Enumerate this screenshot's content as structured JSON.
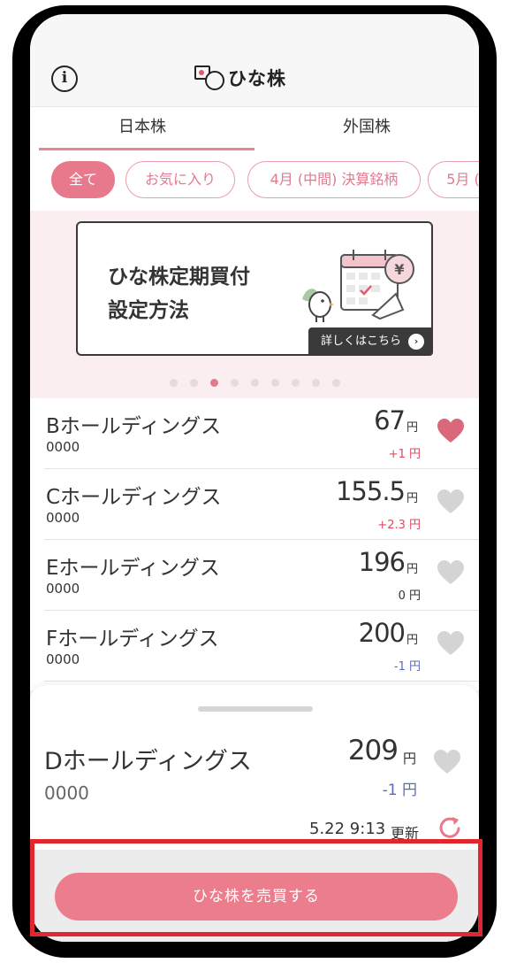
{
  "app": {
    "logo_text": "ひな株"
  },
  "header": {
    "info_icon": "i"
  },
  "tabs": [
    {
      "label": "日本株"
    },
    {
      "label": "外国株"
    }
  ],
  "filters": [
    {
      "label": "全て"
    },
    {
      "label": "お気に入り"
    },
    {
      "label": "4月 (中間) 決算銘柄"
    },
    {
      "label": "5月 ("
    }
  ],
  "banner": {
    "title_line1": "ひな株定期買付",
    "title_line2": "設定方法",
    "cta": "詳しくはこちら",
    "page_count": 9,
    "active_page": 3
  },
  "stocks": [
    {
      "name": "Bホールディングス",
      "code": "0000",
      "price": "67",
      "unit": "円",
      "change": "+1 円",
      "change_color": "#e0495e",
      "favorite": true
    },
    {
      "name": "Cホールディングス",
      "code": "0000",
      "price": "155.5",
      "unit": "円",
      "change": "+2.3 円",
      "change_color": "#e0495e",
      "favorite": false
    },
    {
      "name": "Eホールディングス",
      "code": "0000",
      "price": "196",
      "unit": "円",
      "change": "0 円",
      "change_color": "#333333",
      "favorite": false
    },
    {
      "name": "Fホールディングス",
      "code": "0000",
      "price": "200",
      "unit": "円",
      "change": "-1 円",
      "change_color": "#5a6abf",
      "favorite": false
    }
  ],
  "selected": {
    "name": "Dホールディングス",
    "code": "0000",
    "price": "209",
    "unit": "円",
    "change": "-1 円",
    "updated_time": "5.22 9:13",
    "updated_label": "更新"
  },
  "trade_button": {
    "label": "ひな株を売買する"
  },
  "colors": {
    "accent": "#e8788b",
    "positive": "#e0495e",
    "negative": "#5a6abf",
    "highlight": "#e1262c"
  }
}
